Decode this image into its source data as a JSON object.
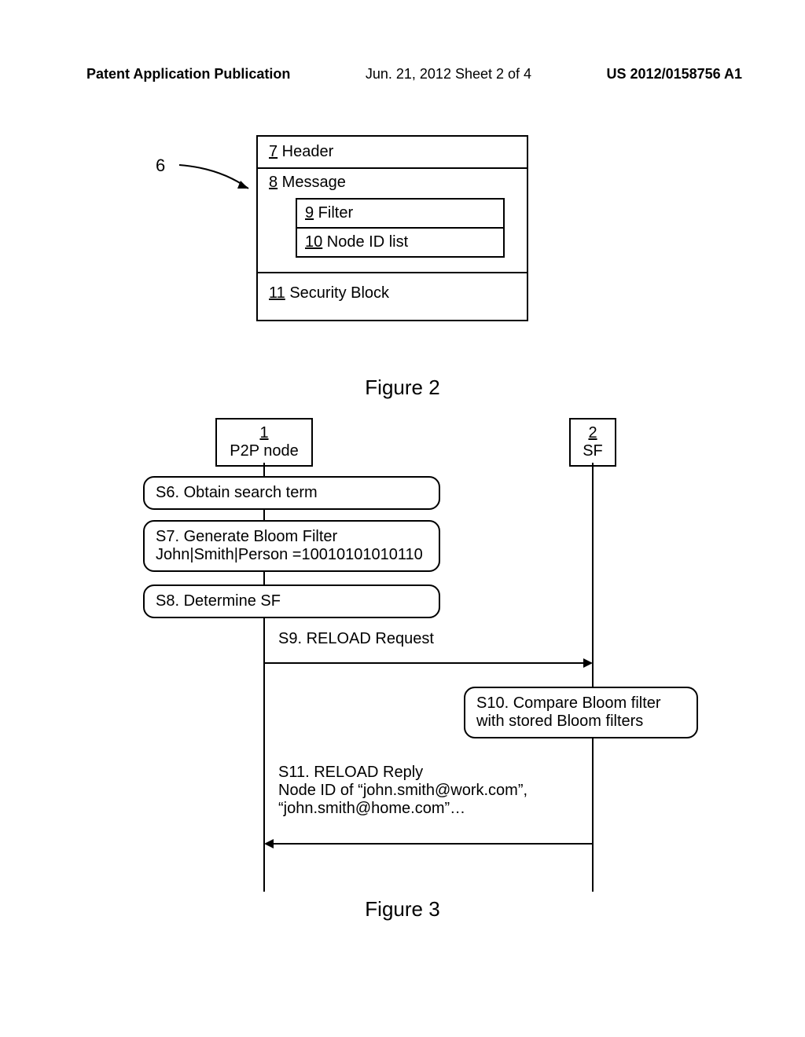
{
  "header": {
    "left": "Patent Application Publication",
    "center": "Jun. 21, 2012  Sheet 2 of 4",
    "right": "US 2012/0158756 A1"
  },
  "figure2": {
    "pointer_label": "6",
    "header_ref": "7",
    "header_text": " Header",
    "message_ref": "8",
    "message_text": " Message",
    "filter_ref": "9",
    "filter_text": " Filter",
    "nodelist_ref": "10",
    "nodelist_text": " Node ID list",
    "security_ref": "11",
    "security_text": " Security Block",
    "caption": "Figure 2"
  },
  "figure3": {
    "p2p_ref": "1",
    "p2p_label": "P2P node",
    "sf_ref": "2",
    "sf_label": "SF",
    "s6": "S6. Obtain search term",
    "s7_line1": "S7. Generate Bloom Filter",
    "s7_line2": "John|Smith|Person =10010101010110",
    "s8": "S8. Determine SF",
    "s9": "S9. RELOAD Request",
    "s10_line1": "S10. Compare Bloom filter",
    "s10_line2": "with stored Bloom filters",
    "s11_line1": "S11. RELOAD Reply",
    "s11_line2": "Node ID of “john.smith@work.com”,",
    "s11_line3": "“john.smith@home.com”…",
    "caption": "Figure 3"
  }
}
